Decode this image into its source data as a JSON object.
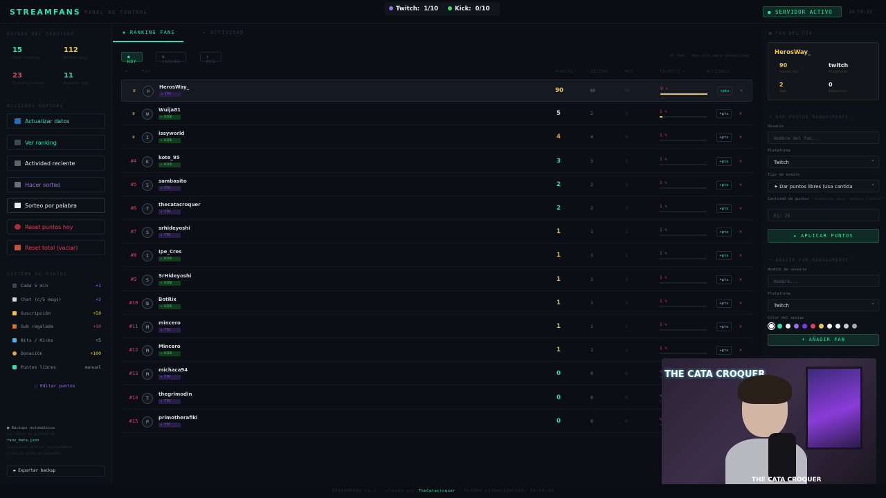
{
  "header": {
    "logo": "STREAMFANS",
    "subtitle": "PANEL DE CONTROL",
    "twitch_label": "Twitch:",
    "twitch_count": "1/10",
    "kick_label": "Kick:",
    "kick_count": "0/10",
    "server_status": "SERVIDOR ACTIVO",
    "clock": "18:58:33"
  },
  "sidebar": {
    "stats_title": "ESTADO DEL SERVIDOR",
    "stats": [
      {
        "value": "15",
        "label": "Fans totales",
        "color": "#2de0b6"
      },
      {
        "value": "112",
        "label": "Puntos hoy",
        "color": "#e8c74a"
      },
      {
        "value": "23",
        "label": "Tickets sorteo",
        "color": "#e0405a"
      },
      {
        "value": "11",
        "label": "Eventos hoy",
        "color": "#2de0b6"
      }
    ],
    "actions_title": "ACCIONES RÁPIDAS",
    "actions": [
      {
        "label": "Actualizar datos",
        "color": "#2de0b6"
      },
      {
        "label": "Ver ranking",
        "color": "#2de0b6"
      },
      {
        "label": "Actividad reciente",
        "color": "#e8eef3"
      },
      {
        "label": "Hacer sorteo",
        "color": "#9a6cf0"
      },
      {
        "label": "Sorteo por palabra",
        "color": "#e8eef3"
      },
      {
        "label": "Reset puntos hoy",
        "color": "#e0405a"
      },
      {
        "label": "Reset total (vaciar)",
        "color": "#e0405a"
      }
    ],
    "points_title": "SISTEMA DE PUNTOS",
    "points": [
      {
        "label": "Cada 5 min",
        "value": "+1",
        "color": "#9a6cf0"
      },
      {
        "label": "Chat (c/5 msgs)",
        "value": "+2",
        "color": "#9a6cf0"
      },
      {
        "label": "Suscripción",
        "value": "+50",
        "color": "#e8c74a"
      },
      {
        "label": "Sub regalada",
        "value": "+30",
        "color": "#e0405a"
      },
      {
        "label": "Bits / Kicks",
        "value": "+5",
        "color": "#2de0b6"
      },
      {
        "label": "Donación",
        "value": "+100",
        "color": "#e8c74a"
      },
      {
        "label": "Puntos libres",
        "value": "manual",
        "color": "#7f8b97"
      }
    ],
    "edit_points": "Editar puntos",
    "backup_title": "Backups automáticos",
    "backup_line1": "Los datos se guardan en",
    "backup_file": "fans_data.json",
    "backup_line2": "Copia este archivo regularmente",
    "backup_line3": "o usa el botón de exportar",
    "export_label": "Exportar backup"
  },
  "main": {
    "tab_ranking": "RANKING FANS",
    "tab_activity": "ACTIVIDAD",
    "filters": [
      "HOY",
      "SEMANA",
      "MES"
    ],
    "hint": "15 fans · Haz clic para seleccionar",
    "columns": [
      "#",
      "FAN",
      "PUNTOS",
      "SESIÓN",
      "MES",
      "TICKETS ✎",
      "ACCIONES"
    ],
    "add_pts_label": "+pts",
    "delete_label": "✕",
    "rows": [
      {
        "rank": "♛",
        "initial": "H",
        "name": "HerosWay_",
        "platform": "TTV",
        "points": "90",
        "session": "90",
        "month": "90",
        "tickets": "9",
        "ticket_fill": 1.0,
        "color": "#e8c74a"
      },
      {
        "rank": "♛",
        "initial": "W",
        "name": "Wuija81",
        "platform": "KICK",
        "points": "5",
        "session": "5",
        "month": "5",
        "tickets": "1",
        "ticket_fill": 0.06,
        "color": "#d0d8e0"
      },
      {
        "rank": "♛",
        "initial": "I",
        "name": "issyworld",
        "platform": "KICK",
        "points": "4",
        "session": "4",
        "month": "4",
        "tickets": "1",
        "ticket_fill": 0.0,
        "color": "#e8a04a"
      },
      {
        "rank": "#4",
        "initial": "K",
        "name": "kote_95",
        "platform": "KICK",
        "points": "3",
        "session": "3",
        "month": "3",
        "tickets": "1",
        "ticket_fill": 0.0,
        "color": "#2de0b6"
      },
      {
        "rank": "#5",
        "initial": "S",
        "name": "sambasito",
        "platform": "TTV",
        "points": "2",
        "session": "2",
        "month": "2",
        "tickets": "1",
        "ticket_fill": 0.0,
        "color": "#2de0b6"
      },
      {
        "rank": "#6",
        "initial": "T",
        "name": "thecatacroquer",
        "platform": "TTV",
        "points": "2",
        "session": "2",
        "month": "2",
        "tickets": "1",
        "ticket_fill": 0.0,
        "color": "#2de0b6"
      },
      {
        "rank": "#7",
        "initial": "S",
        "name": "srhideyoshi",
        "platform": "TTV",
        "points": "1",
        "session": "1",
        "month": "1",
        "tickets": "1",
        "ticket_fill": 0.0,
        "color": "#e8c74a"
      },
      {
        "rank": "#8",
        "initial": "I",
        "name": "Ipe_Cres",
        "platform": "KICK",
        "points": "1",
        "session": "1",
        "month": "1",
        "tickets": "1",
        "ticket_fill": 0.0,
        "color": "#e8c74a"
      },
      {
        "rank": "#9",
        "initial": "S",
        "name": "SrHideyoshi",
        "platform": "KICK",
        "points": "1",
        "session": "1",
        "month": "1",
        "tickets": "1",
        "ticket_fill": 0.0,
        "color": "#e8c74a"
      },
      {
        "rank": "#10",
        "initial": "B",
        "name": "BotRix",
        "platform": "KICK",
        "points": "1",
        "session": "1",
        "month": "1",
        "tickets": "1",
        "ticket_fill": 0.0,
        "color": "#e8c74a"
      },
      {
        "rank": "#11",
        "initial": "M",
        "name": "mincero",
        "platform": "TTV",
        "points": "1",
        "session": "1",
        "month": "1",
        "tickets": "1",
        "ticket_fill": 0.0,
        "color": "#e8c74a"
      },
      {
        "rank": "#12",
        "initial": "M",
        "name": "Mincero",
        "platform": "KICK",
        "points": "1",
        "session": "1",
        "month": "1",
        "tickets": "1",
        "ticket_fill": 0.0,
        "color": "#e8c74a"
      },
      {
        "rank": "#13",
        "initial": "M",
        "name": "michaca94",
        "platform": "TTV",
        "points": "0",
        "session": "0",
        "month": "0",
        "tickets": "",
        "ticket_fill": 0.0,
        "color": "#2de0b6"
      },
      {
        "rank": "#14",
        "initial": "T",
        "name": "thegrimodin",
        "platform": "TTV",
        "points": "0",
        "session": "0",
        "month": "0",
        "tickets": "",
        "ticket_fill": 0.0,
        "color": "#2de0b6"
      },
      {
        "rank": "#15",
        "initial": "P",
        "name": "primotherafiki",
        "platform": "TTV",
        "points": "0",
        "session": "0",
        "month": "0",
        "tickets": "",
        "ticket_fill": 0.0,
        "color": "#2de0b6"
      }
    ]
  },
  "right": {
    "fan_title": "FAN DEL DÍA",
    "fan_name": "HerosWay_",
    "fan_points": "90",
    "fan_points_label": "Puntos hoy",
    "fan_platform": "twitch",
    "fan_platform_label": "Plataforma",
    "fan_subs": "2",
    "fan_subs_label": "Subs",
    "fan_donations": "0",
    "fan_donations_label": "Donaciones",
    "give_title": "DAR PUNTOS MANUALMENTE",
    "user_label": "Usuario",
    "user_placeholder": "Nombre del fan...",
    "platform_label": "Plataforma",
    "platform_value": "Twitch",
    "event_label": "Tipo de evento",
    "event_value": "✦ Dar puntos libres (usa cantida",
    "amount_label": "Cantidad de puntos",
    "amount_hint": "(requerido para \"puntos libres\")",
    "amount_placeholder": "Ej: 25",
    "apply_label": "★ APLICAR PUNTOS",
    "add_title": "AÑADIR FAN MANUALMENTE",
    "newname_label": "Nombre de usuario",
    "newname_placeholder": "Nombre...",
    "newplatform_label": "Plataforma",
    "newplatform_value": "Twitch",
    "color_label": "Color del avatar",
    "colors": [
      "#ffffff",
      "#2de0b6",
      "#e8eef3",
      "#9a6cf0",
      "#7c3aed",
      "#e0405a",
      "#e8c74a",
      "#ffffff",
      "#e8eef3",
      "#cccccc",
      "#aaaaaa"
    ],
    "add_fan_label": "+ AÑADIR FAN"
  },
  "footer": {
    "left": "STREAMFANS v1.2 · creado por",
    "creator": "TheCatacroquer",
    "right": "· ÚLTIMA ACTUALIZACIÓN: 18:58:33"
  },
  "webcam": {
    "overlay_logo": "THE CATA CROQUER",
    "brand": "THE CATA CROQUER"
  }
}
